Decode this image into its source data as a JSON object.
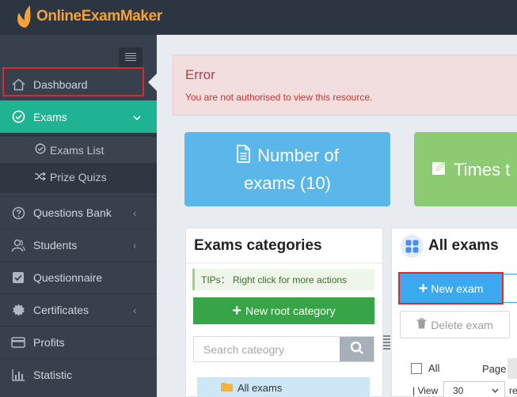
{
  "app": {
    "logo_text": "OnlineExamMaker"
  },
  "sidebar": {
    "items": [
      {
        "label": "Dashboard",
        "icon": "home-icon"
      },
      {
        "label": "Exams",
        "icon": "check-circle-icon",
        "active": true
      },
      {
        "label": "Questions Bank",
        "icon": "question-circle-icon"
      },
      {
        "label": "Students",
        "icon": "users-icon"
      },
      {
        "label": "Questionnaire",
        "icon": "checkbox-icon"
      },
      {
        "label": "Certificates",
        "icon": "certificate-icon"
      },
      {
        "label": "Profits",
        "icon": "credit-card-icon"
      },
      {
        "label": "Statistic",
        "icon": "bar-chart-icon"
      }
    ],
    "submenu": [
      {
        "label": "Exams List",
        "icon": "check-circle-icon"
      },
      {
        "label": "Prize Quizs",
        "icon": "shuffle-icon"
      }
    ]
  },
  "error": {
    "title": "Error",
    "message": "You are not authorised to view this resource."
  },
  "cards": {
    "exams_line1": "Number of",
    "exams_line2": "exams (10)",
    "times_label": "Times t"
  },
  "categories": {
    "title": "Exams categories",
    "tips": "TIPs： Right click for more actions",
    "new_root_label": "New root category",
    "search_placeholder": "Search cateogry",
    "tree_root": "All exams"
  },
  "exams": {
    "title": "All exams",
    "new_label": "New exam",
    "delete_label": "Delete exam",
    "select_all_label": "All",
    "page_label": "Page",
    "view_label": "| View",
    "view_value": "30",
    "view_tail": "re"
  },
  "colors": {
    "topbar": "#2b3642",
    "sidebar": "#36414d",
    "active": "#1eb392",
    "brand": "#f6a23a",
    "highlight": "#e2272b"
  }
}
